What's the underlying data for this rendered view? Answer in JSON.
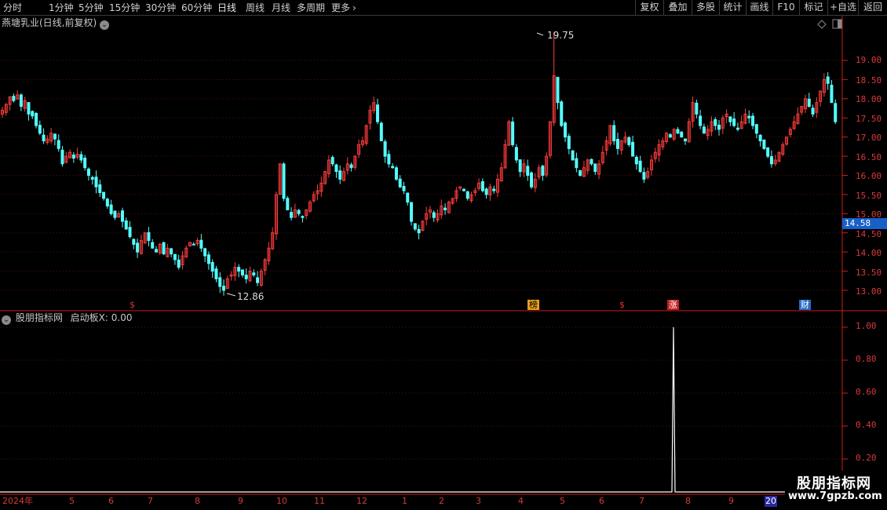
{
  "toolbar": {
    "periods": [
      "分时",
      "1分钟",
      "5分钟",
      "15分钟",
      "30分钟",
      "60分钟",
      "日线",
      "周线",
      "月线",
      "多周期",
      "更多"
    ],
    "active_period": "日线",
    "buttons": [
      "复权",
      "叠加",
      "多股",
      "统计",
      "画线",
      "F10",
      "标记",
      "+自选",
      "返回"
    ]
  },
  "main_chart": {
    "title": "燕塘乳业(日线,前复权)",
    "y_ticks": [
      "19.00",
      "18.50",
      "18.00",
      "17.50",
      "17.00",
      "16.50",
      "16.00",
      "15.50",
      "15.00",
      "14.50",
      "14.00",
      "13.50",
      "13.00"
    ],
    "current_price": "14.58",
    "max_label": "19.75",
    "min_label": "12.86",
    "event_tags": [
      {
        "text": "$",
        "color": "#e03030"
      },
      {
        "text": "榜",
        "color": "#e8a020"
      },
      {
        "text": "$",
        "color": "#e03030"
      },
      {
        "text": "涨",
        "color": "#e03030"
      },
      {
        "text": "财",
        "color": "#3a8ae0"
      }
    ]
  },
  "indicator": {
    "title": "股朋指标网",
    "line_label": "启动板X: 0.00",
    "y_ticks": [
      "1.00",
      "0.80",
      "0.60",
      "0.40",
      "0.20"
    ]
  },
  "time_axis": [
    "2024年",
    "5",
    "6",
    "7",
    "8",
    "9",
    "10",
    "11",
    "12",
    "1",
    "2",
    "3",
    "4",
    "5",
    "6",
    "7",
    "8",
    "9",
    "20"
  ],
  "watermark": {
    "cn": "股朋指标网",
    "url": "www.7gpzb.com"
  },
  "colors": {
    "up": "#ff3c3c",
    "down": "#54ffff",
    "axis": "#c81e1e",
    "grid": "#5a0f0f"
  },
  "chart_data": {
    "type": "candlestick",
    "title": "燕塘乳业(日线,前复权)",
    "ylim": [
      12.6,
      20.0
    ],
    "closes": [
      17.7,
      17.85,
      18.05,
      17.95,
      18.1,
      17.8,
      17.95,
      17.6,
      17.55,
      17.3,
      17.1,
      16.9,
      16.95,
      17.1,
      16.95,
      16.7,
      16.3,
      16.5,
      16.6,
      16.45,
      16.55,
      16.4,
      16.2,
      16.0,
      15.9,
      15.7,
      15.55,
      15.4,
      15.2,
      15.0,
      14.9,
      15.0,
      14.8,
      14.6,
      14.4,
      14.2,
      14.0,
      14.3,
      14.5,
      14.3,
      14.1,
      14.0,
      14.2,
      13.95,
      14.1,
      13.95,
      13.8,
      13.6,
      13.9,
      14.1,
      14.25,
      14.2,
      14.3,
      14.1,
      13.9,
      13.7,
      13.5,
      13.3,
      13.1,
      13.0,
      13.3,
      13.4,
      13.6,
      13.5,
      13.4,
      13.3,
      13.5,
      13.4,
      13.2,
      13.5,
      13.8,
      14.1,
      14.5,
      15.5,
      16.3,
      15.4,
      15.1,
      14.9,
      15.1,
      15.0,
      14.9,
      15.1,
      15.3,
      15.5,
      15.6,
      15.8,
      16.1,
      16.4,
      16.3,
      16.1,
      15.9,
      16.1,
      16.3,
      16.2,
      16.5,
      16.8,
      16.9,
      17.3,
      17.7,
      17.9,
      17.4,
      16.9,
      16.5,
      16.3,
      16.2,
      15.9,
      15.7,
      15.6,
      15.3,
      14.8,
      14.6,
      14.5,
      14.8,
      15.0,
      15.1,
      14.9,
      15.0,
      15.2,
      15.1,
      15.3,
      15.4,
      15.6,
      15.7,
      15.6,
      15.4,
      15.5,
      15.6,
      15.8,
      15.6,
      15.5,
      15.7,
      15.6,
      15.9,
      16.2,
      16.8,
      17.4,
      16.8,
      16.4,
      16.1,
      16.3,
      16.0,
      15.7,
      15.9,
      16.2,
      16.0,
      16.5,
      17.4,
      18.6,
      17.9,
      17.3,
      17.0,
      16.7,
      16.4,
      16.2,
      16.0,
      16.2,
      16.4,
      16.3,
      16.1,
      16.3,
      16.6,
      16.9,
      17.3,
      16.9,
      16.7,
      16.9,
      17.0,
      16.8,
      16.5,
      16.3,
      16.1,
      15.9,
      16.1,
      16.4,
      16.6,
      16.8,
      16.9,
      17.1,
      17.0,
      17.2,
      17.1,
      17.0,
      16.9,
      17.4,
      17.9,
      17.6,
      17.3,
      17.1,
      17.2,
      17.4,
      17.3,
      17.2,
      17.5,
      17.6,
      17.4,
      17.3,
      17.2,
      17.4,
      17.6,
      17.5,
      17.3,
      17.1,
      16.9,
      16.7,
      16.5,
      16.3,
      16.4,
      16.6,
      16.8,
      17.0,
      17.2,
      17.4,
      17.6,
      17.8,
      18.0,
      17.8,
      17.6,
      17.9,
      18.2,
      18.5,
      18.4,
      17.9,
      17.4
    ],
    "max": 19.75,
    "min": 12.86,
    "indicator": {
      "name": "启动板X",
      "ylim": [
        0,
        1.05
      ],
      "spike_value": 1.0,
      "last_value": 0.0
    }
  }
}
